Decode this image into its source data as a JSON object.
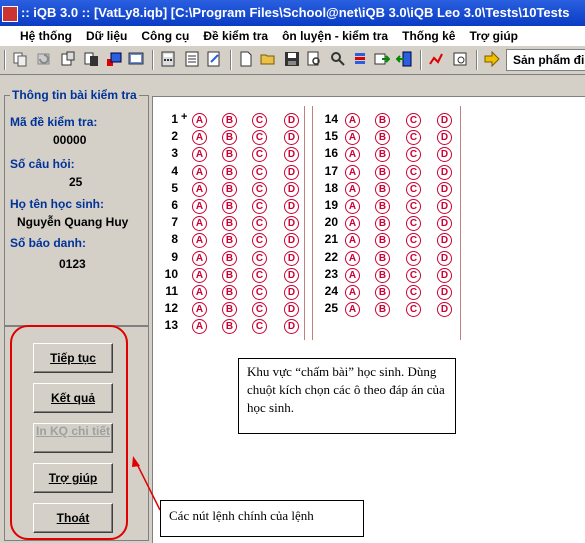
{
  "window": {
    "title": ":: iQB 3.0 :: [VatLy8.iqb]  [C:\\Program Files\\School@net\\iQB 3.0\\iQB Leo 3.0\\Tests\\10Tests"
  },
  "menu": {
    "items": [
      "Hệ thống",
      "Dữ liệu",
      "Công cụ",
      "Đề kiểm tra",
      "ôn luyện - kiểm tra",
      "Thống kê",
      "Trợ giúp"
    ]
  },
  "toolbar": {
    "product_dropdown": "Sản phẩm đi"
  },
  "info_panel": {
    "title": "Thông tin bài kiểm tra",
    "exam_code_label": "Mã đề kiểm tra:",
    "exam_code": "00000",
    "question_count_label": "Số câu hỏi:",
    "question_count": "25",
    "student_name_label": "Họ tên học sinh:",
    "student_name": "Nguyễn Quang Huy",
    "student_id_label": "Số báo danh:",
    "student_id": "0123"
  },
  "buttons": {
    "continue": "Tiếp tục",
    "result": "Kết quả",
    "print_detail": "In KQ chi tiết",
    "help": "Trợ giúp",
    "exit": "Thoát"
  },
  "answer_sheet": {
    "choices": [
      "A",
      "B",
      "C",
      "D"
    ],
    "left_questions": [
      "1",
      "2",
      "3",
      "4",
      "5",
      "6",
      "7",
      "8",
      "9",
      "10",
      "11",
      "12",
      "13"
    ],
    "right_questions": [
      "14",
      "15",
      "16",
      "17",
      "18",
      "19",
      "20",
      "21",
      "22",
      "23",
      "24",
      "25"
    ]
  },
  "annotations": {
    "grading_area_note": "Khu vực “chấm bài” học sinh. Dùng chuột kích chọn các ô theo đáp án của học sinh.",
    "buttons_note": "Các nút lệnh chính của lệnh"
  },
  "colors": {
    "title_bar": "#0a3cc4",
    "label_blue": "#003399",
    "bubble_red": "#cc0033",
    "callout_red": "#e00000"
  }
}
